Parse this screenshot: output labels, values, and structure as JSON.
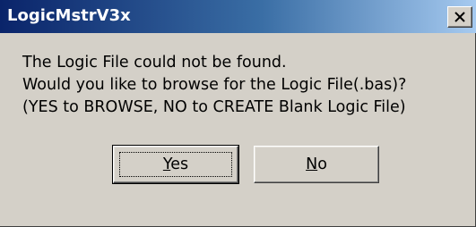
{
  "window": {
    "title": "LogicMstrV3x",
    "close_glyph": "✕",
    "title_gradient_start": "#0a246a",
    "title_gradient_end": "#a6caf0",
    "face_color": "#d4d0c8"
  },
  "message": {
    "lines": [
      "The Logic File could not be found.",
      "Would you like to browse for the Logic File(.bas)?",
      "(YES to BROWSE,  NO to CREATE Blank Logic File)"
    ]
  },
  "buttons": {
    "yes": {
      "mnemonic": "Y",
      "rest": "es"
    },
    "no": {
      "mnemonic": "N",
      "rest": "o"
    }
  },
  "icons": [
    "close-icon"
  ]
}
